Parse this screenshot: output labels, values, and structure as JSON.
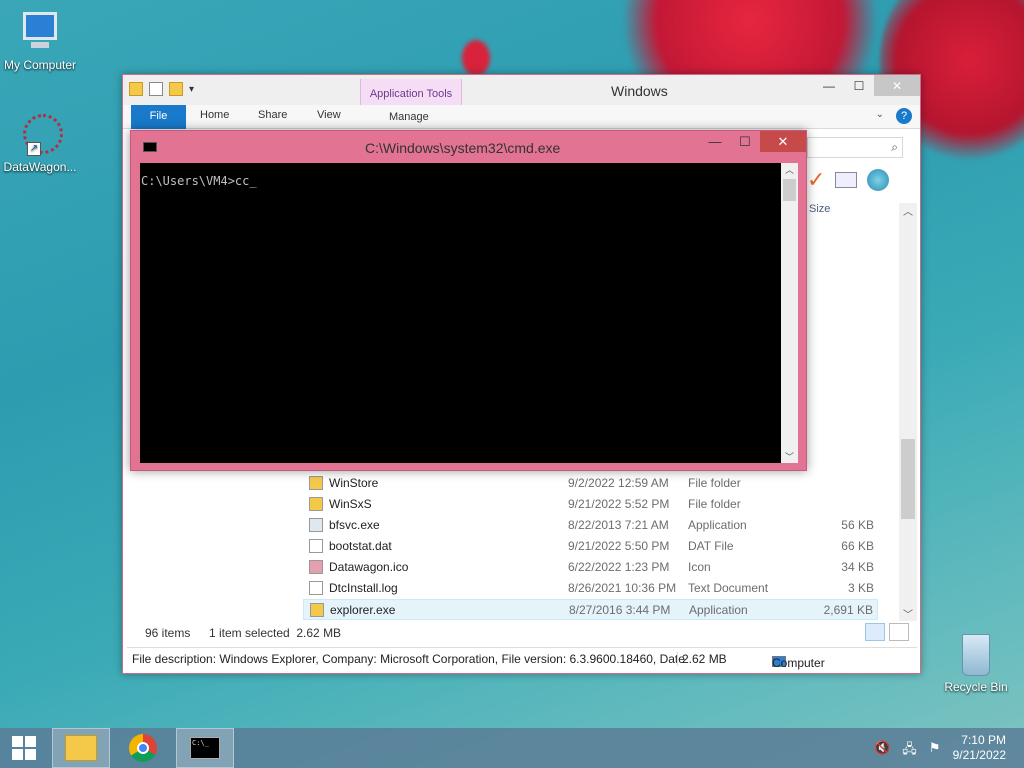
{
  "desktop": {
    "icons": [
      {
        "label": "My Computer"
      },
      {
        "label": "DataWagon..."
      },
      {
        "label": "Recycle Bin"
      }
    ]
  },
  "explorer": {
    "title": "Windows",
    "context_tab_group": "Application Tools",
    "tabs": {
      "file": "File",
      "home": "Home",
      "share": "Share",
      "view": "View",
      "manage": "Manage"
    },
    "size_header": "Size",
    "rows": [
      {
        "name": "WinStore",
        "date": "9/2/2022 12:59 AM",
        "type": "File folder",
        "size": "",
        "icon": "folder-icon"
      },
      {
        "name": "WinSxS",
        "date": "9/21/2022 5:52 PM",
        "type": "File folder",
        "size": "",
        "icon": "folder-icon"
      },
      {
        "name": "bfsvc.exe",
        "date": "8/22/2013 7:21 AM",
        "type": "Application",
        "size": "56 KB",
        "icon": "app-icon"
      },
      {
        "name": "bootstat.dat",
        "date": "9/21/2022 5:50 PM",
        "type": "DAT File",
        "size": "66 KB",
        "icon": "file-icon"
      },
      {
        "name": "Datawagon.ico",
        "date": "6/22/2022 1:23 PM",
        "type": "Icon",
        "size": "34 KB",
        "icon": "ico-file-icon"
      },
      {
        "name": "DtcInstall.log",
        "date": "8/26/2021 10:36 PM",
        "type": "Text Document",
        "size": "3 KB",
        "icon": "text-file-icon"
      },
      {
        "name": "explorer.exe",
        "date": "8/27/2016 3:44 PM",
        "type": "Application",
        "size": "2,691 KB",
        "icon": "explorer-icon",
        "selected": true
      }
    ],
    "status": {
      "items": "96 items",
      "selected": "1 item selected  2.62 MB"
    },
    "details": {
      "description": "File description: Windows Explorer, Company: Microsoft Corporation, File version: 6.3.9600.18460, Date",
      "size": "2.62 MB",
      "location": "Computer"
    }
  },
  "cmd": {
    "title": "C:\\Windows\\system32\\cmd.exe",
    "prompt": "C:\\Users\\VM4>cc"
  },
  "taskbar": {
    "time": "7:10 PM",
    "date": "9/21/2022"
  }
}
